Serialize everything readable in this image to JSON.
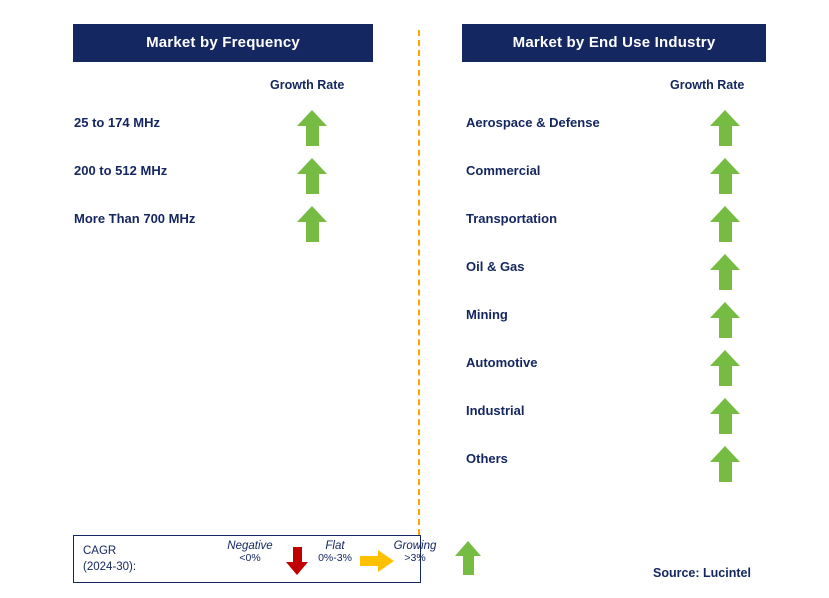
{
  "panels": [
    {
      "id": "market-by-frequency",
      "title": "Market by Frequency",
      "growth_header": "Growth Rate",
      "rows": [
        {
          "label": "25 to 174 MHz",
          "trend": "growing"
        },
        {
          "label": "200 to 512 MHz",
          "trend": "growing"
        },
        {
          "label": "More Than 700 MHz",
          "trend": "growing"
        }
      ]
    },
    {
      "id": "market-by-end-use-industry",
      "title": "Market by End Use Industry",
      "growth_header": "Growth Rate",
      "rows": [
        {
          "label": "Aerospace & Defense",
          "trend": "growing"
        },
        {
          "label": "Commercial",
          "trend": "growing"
        },
        {
          "label": "Transportation",
          "trend": "growing"
        },
        {
          "label": "Oil & Gas",
          "trend": "growing"
        },
        {
          "label": "Mining",
          "trend": "growing"
        },
        {
          "label": "Automotive",
          "trend": "growing"
        },
        {
          "label": "Industrial",
          "trend": "growing"
        },
        {
          "label": "Others",
          "trend": "growing"
        }
      ]
    }
  ],
  "legend": {
    "cagr_line1": "CAGR",
    "cagr_line2": "(2024-30):",
    "items": [
      {
        "title": "Negative",
        "range": "<0%"
      },
      {
        "title": "Flat",
        "range": "0%-3%"
      },
      {
        "title": "Growing",
        "range": ">3%"
      }
    ]
  },
  "source": "Source: Lucintel",
  "colors": {
    "brand_navy": "#152761",
    "growing_green": "#76bc43",
    "negative_red": "#c00000",
    "flat_orange": "#ffc000",
    "divider_orange": "#ffa300"
  }
}
